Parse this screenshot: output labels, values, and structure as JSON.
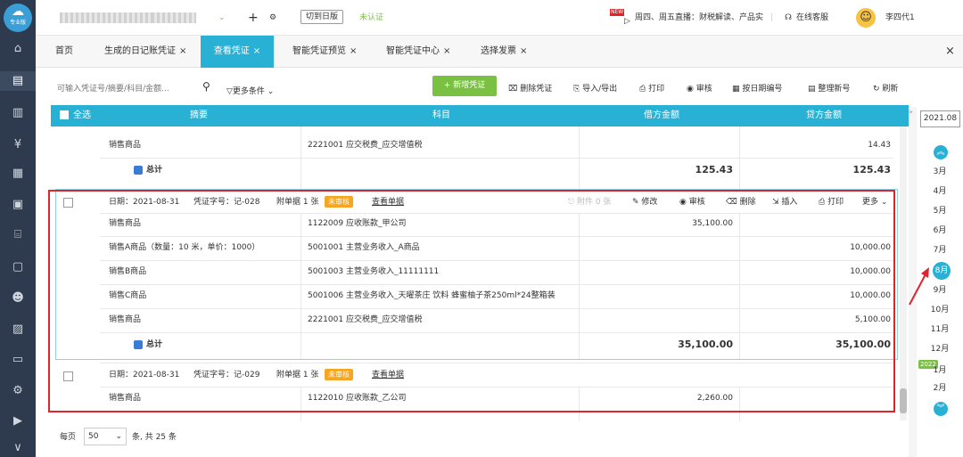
{
  "app": {
    "logo_label": "专业版",
    "user_name": "李四代1",
    "unverified": "未认证",
    "switch_btn": "切到日版",
    "promo": "周四、周五直播：财税解读、产品实",
    "online_service": "在线客服",
    "new_badge": "NEW"
  },
  "tabs": [
    {
      "label": "首页",
      "close": ""
    },
    {
      "label": "生成的日记账凭证",
      "close": "×"
    },
    {
      "label": "查看凭证",
      "close": "×"
    },
    {
      "label": "智能凭证预览",
      "close": "×"
    },
    {
      "label": "智能凭证中心",
      "close": "×"
    },
    {
      "label": "选择发票",
      "close": "×"
    }
  ],
  "search": {
    "placeholder": "可输入凭证号/摘要/科目/金额...",
    "more": "更多条件"
  },
  "toolbar": {
    "add": "+ 新增凭证",
    "delete": "删除凭证",
    "import": "导入/导出",
    "print": "打印",
    "audit": "审核",
    "by_date": "按日期编号",
    "renumber": "整理新号",
    "refresh": "刷新"
  },
  "grid_header": {
    "select_all": "全选",
    "summary": "摘要",
    "subject": "科目",
    "debit": "借方金额",
    "credit": "贷方金额"
  },
  "prev_block": {
    "row": {
      "summary": "销售商品",
      "subject": "2221001 应交税费_应交增值税",
      "debit": "",
      "credit": "14.43"
    },
    "total_label": "总计",
    "total_debit": "125.43",
    "total_credit": "125.43"
  },
  "voucher1": {
    "date": "日期：2021-08-31",
    "no": "凭证字号：记-028",
    "attach": "附单据 1 张",
    "status": "未审核",
    "view": "查看单据",
    "actions": {
      "attach_count": "附件 0 张",
      "edit": "修改",
      "audit": "审核",
      "delete": "删除",
      "insert": "插入",
      "print": "打印",
      "more": "更多"
    },
    "rows": [
      {
        "summary": "销售商品",
        "subject": "1122009 应收账款_甲公司",
        "debit": "35,100.00",
        "credit": ""
      },
      {
        "summary": "销售A商品（数量：10 米，单价：1000）",
        "subject": "5001001 主营业务收入_A商品",
        "debit": "",
        "credit": "10,000.00"
      },
      {
        "summary": "销售B商品",
        "subject": "5001003 主营业务收入_11111111",
        "debit": "",
        "credit": "10,000.00"
      },
      {
        "summary": "销售C商品",
        "subject": "5001006 主营业务收入_天曜茶庄 饮料 蜂蜜柚子茶250ml*24整箱装",
        "debit": "",
        "credit": "10,000.00"
      },
      {
        "summary": "销售商品",
        "subject": "2221001 应交税费_应交增值税",
        "debit": "",
        "credit": "5,100.00"
      }
    ],
    "total_label": "总计",
    "total_debit": "35,100.00",
    "total_credit": "35,100.00"
  },
  "voucher2": {
    "date": "日期：2021-08-31",
    "no": "凭证字号：记-029",
    "attach": "附单据 1 张",
    "status": "未审核",
    "view": "查看单据",
    "rows": [
      {
        "summary": "销售商品",
        "subject": "1122010 应收账款_乙公司",
        "debit": "2,260.00",
        "credit": ""
      }
    ]
  },
  "pager": {
    "per_page_label": "每页",
    "per_page": "50",
    "total": "条, 共 25 条"
  },
  "calendar": {
    "period": "2021.08",
    "months": [
      "3月",
      "4月",
      "5月",
      "6月",
      "7月",
      "8月",
      "9月",
      "10月",
      "11月",
      "12月",
      "1月",
      "2月"
    ],
    "year_badge": "2022",
    "active_month": "8月"
  },
  "colors": {
    "accent": "#29b1d5",
    "sidebar": "#2e3b4e",
    "add_button": "#7ac143",
    "highlight_box": "#e0242b",
    "badge": "#f5a623"
  }
}
